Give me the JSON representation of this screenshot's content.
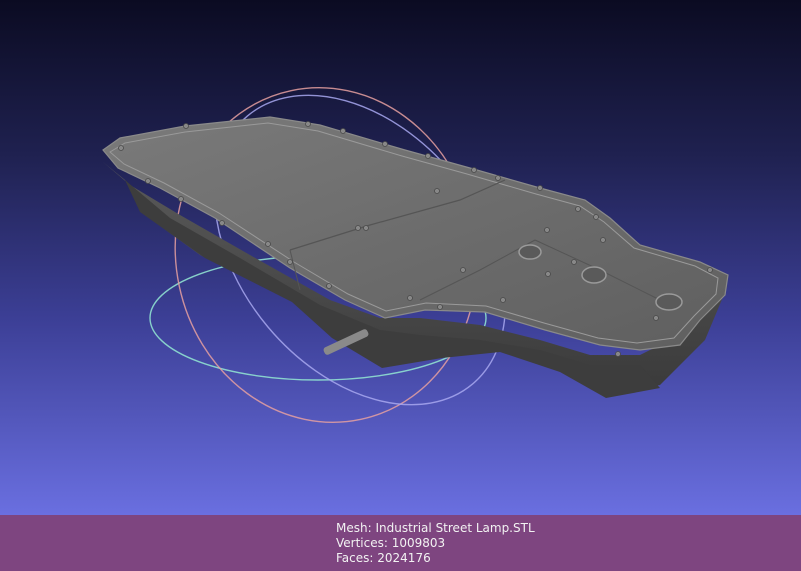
{
  "viewer": {
    "background_top": "#0b0b22",
    "background_bottom": "#6a6fe0",
    "model_color": "#6e6e6e"
  },
  "info": {
    "bar_color": "#7e4580",
    "mesh_label": "Mesh:",
    "mesh_name": "Industrial Street Lamp.STL",
    "vertices_label": "Vertices:",
    "vertices_value": "1009803",
    "faces_label": "Faces:",
    "faces_value": "2024176"
  },
  "trackball": {
    "icon": "trackball-rings-icon",
    "colors": [
      "#e6a0a0",
      "#a8a8f0",
      "#8fe0d0"
    ]
  }
}
